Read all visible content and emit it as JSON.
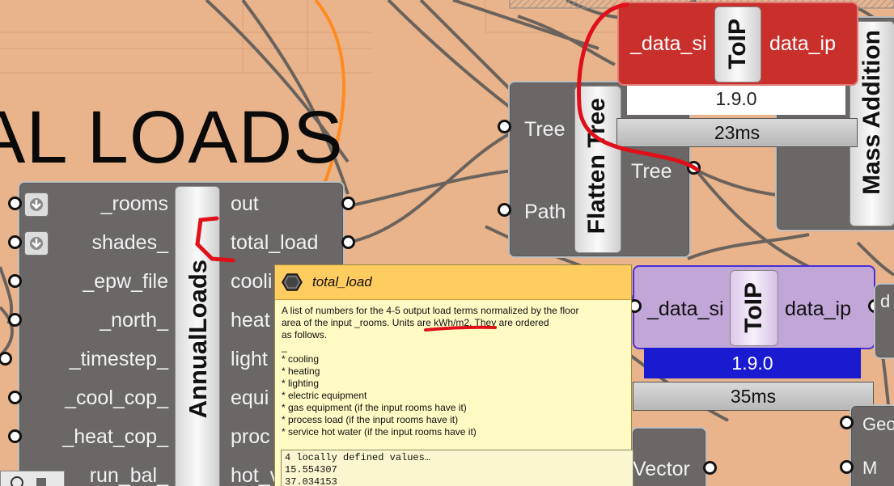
{
  "group": {
    "title": "AL LOADS"
  },
  "annual_loads": {
    "name": "AnnualLoads",
    "inputs": [
      "_rooms",
      "shades_",
      "_epw_file",
      "_north_",
      "_timestep_",
      "_cool_cop_",
      "_heat_cop_",
      "run_bal_"
    ],
    "outputs": [
      "out",
      "total_load",
      "cooli",
      "heat",
      "light",
      "equi",
      "proc",
      "hot_v"
    ]
  },
  "flatten_tree": {
    "name": "Flatten Tree",
    "inputs": [
      "Tree",
      "Path"
    ],
    "output": "Tree"
  },
  "toip_top": {
    "name": "ToIP",
    "input": "_data_si",
    "output": "data_ip",
    "version": "1.9.0",
    "time": "23ms"
  },
  "toip_bottom": {
    "name": "ToIP",
    "input": "_data_si",
    "output": "data_ip",
    "version": "1.9.0",
    "time": "35ms"
  },
  "mass_addition": {
    "name": "Mass Addition"
  },
  "partial_labels": {
    "vector": "Vector",
    "geo": "Geo",
    "m": "M",
    "d": "d"
  },
  "tooltip": {
    "title": "total_load",
    "description": "A list of numbers for the 4-5 output load terms normalized by the floor\narea of the input _rooms. Units are kWh/m2. They are ordered\nas follows.\n_\n* cooling\n* heating\n* lighting\n* electric equipment\n* gas equipment (if the input rooms have it)\n* process load (if the input rooms have it)\n* service hot water (if the input rooms have it)",
    "values_header": "4 locally defined values…",
    "values": [
      "15.554307",
      "37.034153"
    ]
  },
  "colors": {
    "canvas": "#e9b48b",
    "component": "#6a6766",
    "toip_red": "#c9302c",
    "toip_purple": "#c2a6d8",
    "version_blue": "#1a1ad0",
    "tooltip_header": "#ffcc60",
    "tooltip_body": "#fff9c4",
    "annotation_red": "#e0101a"
  }
}
